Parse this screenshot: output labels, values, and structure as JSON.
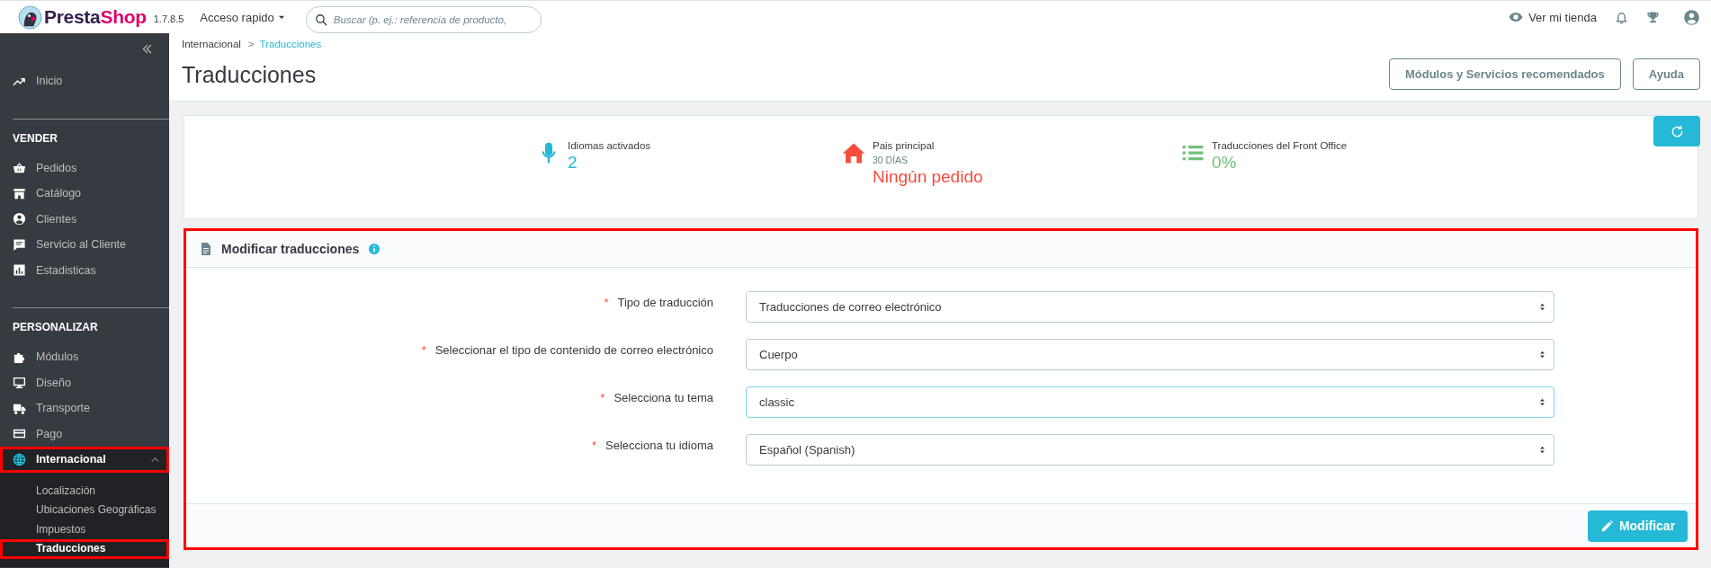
{
  "header": {
    "brand": {
      "name_start": "Presta",
      "name_end": "Shop"
    },
    "version": "1.7.8.5",
    "quick_access": "Acceso rapido",
    "search": {
      "placeholder": "Buscar (p. ej.: referencia de producto,"
    },
    "view_store": "Ver mi tienda"
  },
  "sidebar": {
    "sections": [
      {
        "items": [
          {
            "label": "Inicio",
            "selected": false,
            "highlighted": false
          }
        ]
      },
      {
        "heading": "VENDER",
        "items": [
          {
            "label": "Pedidos",
            "selected": false,
            "highlighted": false
          },
          {
            "label": "Catálogo",
            "selected": false,
            "highlighted": false
          },
          {
            "label": "Clientes",
            "selected": false,
            "highlighted": false
          },
          {
            "label": "Servicio al Cliente",
            "selected": false,
            "highlighted": false
          },
          {
            "label": "Estadisticas",
            "selected": false,
            "highlighted": false
          }
        ]
      },
      {
        "heading": "PERSONALIZAR",
        "items": [
          {
            "label": "Módulos",
            "selected": false,
            "highlighted": false
          },
          {
            "label": "Diseño",
            "selected": false,
            "highlighted": false
          },
          {
            "label": "Transporte",
            "selected": false,
            "highlighted": false
          },
          {
            "label": "Pago",
            "selected": false,
            "highlighted": false
          },
          {
            "label": "Internacional",
            "selected": true,
            "highlighted": true,
            "expanded": true,
            "children": [
              {
                "label": "Localización",
                "selected": false,
                "highlighted": false
              },
              {
                "label": "Ubicaciones Geográficas",
                "selected": false,
                "highlighted": false
              },
              {
                "label": "Impuestos",
                "selected": false,
                "highlighted": false
              },
              {
                "label": "Traducciones",
                "selected": true,
                "highlighted": true
              }
            ]
          }
        ]
      }
    ]
  },
  "breadcrumb": {
    "parent": "Internacional",
    "separator": ">",
    "current": "Traducciones"
  },
  "page_title": "Traducciones",
  "toolbar_buttons": [
    "Módulos y Servicios recomendados",
    "Ayuda"
  ],
  "stats": [
    {
      "label": "Idiomas activados",
      "value": "2",
      "color": "#25b9d7"
    },
    {
      "label": "Pais principal",
      "sublabel": "30 DÍAS",
      "value": "Ningún pedido",
      "color": "#f54c3e"
    },
    {
      "label": "Traducciones del Front Office",
      "value": "0%",
      "color": "#72c279"
    }
  ],
  "form_panel": {
    "title": "Modificar traducciones",
    "highlighted": true,
    "fields": [
      {
        "required_mark": "*",
        "label": "Tipo de traducción",
        "value": "Traducciones de correo electrónico",
        "focused": false
      },
      {
        "required_mark": "*",
        "label": "Seleccionar el tipo de contenido de correo electrónico",
        "value": "Cuerpo",
        "focused": false
      },
      {
        "required_mark": "*",
        "label": "Selecciona tu tema",
        "value": "classic",
        "focused": true
      },
      {
        "required_mark": "*",
        "label": "Selecciona tu idioma",
        "value": "Español (Spanish)",
        "focused": false
      }
    ],
    "submit": "Modificar"
  }
}
